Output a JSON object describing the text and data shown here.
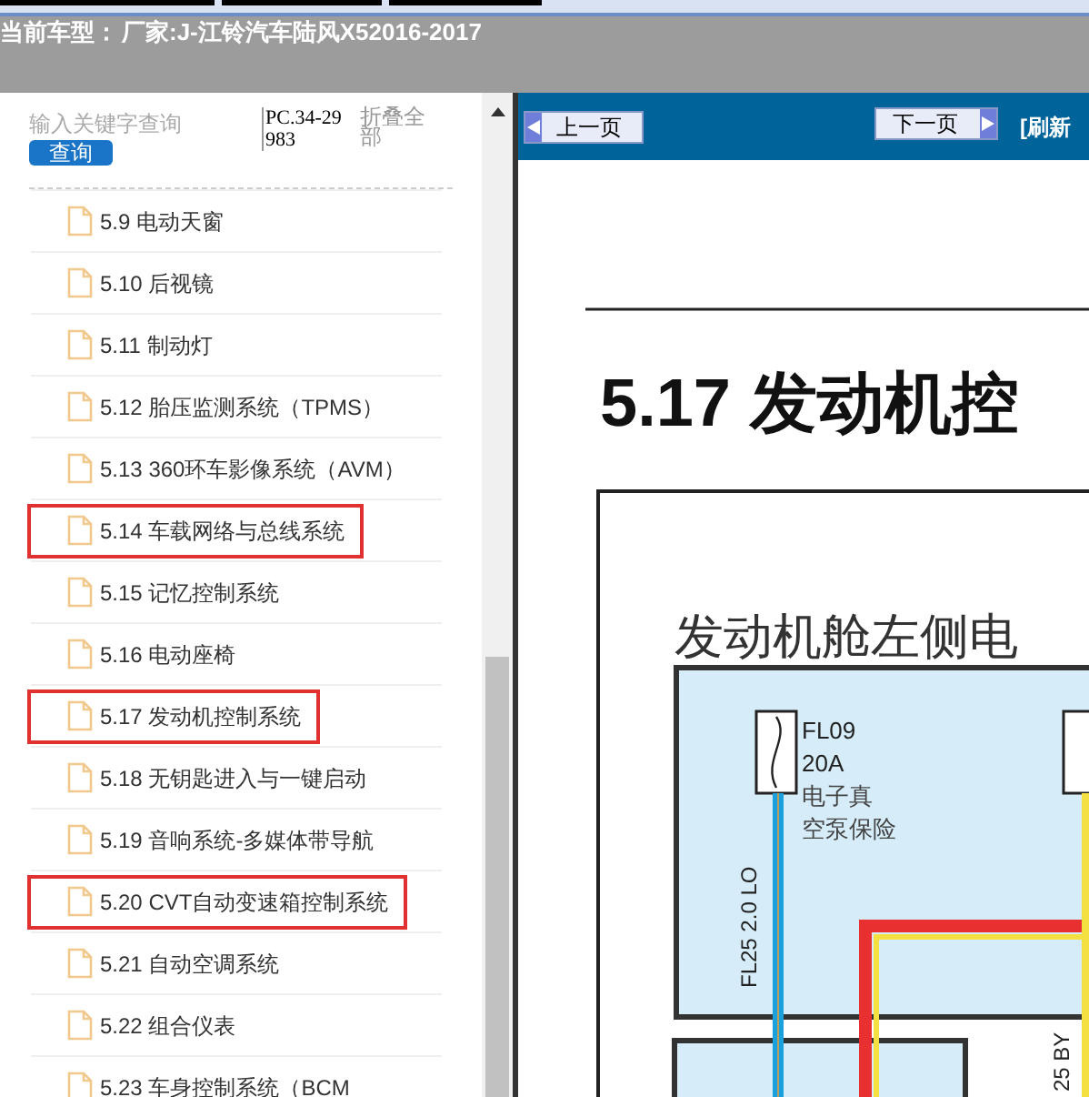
{
  "header": {
    "label": "当前车型：",
    "model": "厂家:J-江铃汽车陆风X52016-2017"
  },
  "sidebar": {
    "search": {
      "placeholder": "输入关键字查询"
    },
    "search_button": "查询",
    "code": "PC.34-29983",
    "collapse_all": "折叠全部",
    "items": [
      {
        "label": "5.9 电动天窗",
        "highlighted": false
      },
      {
        "label": "5.10 后视镜",
        "highlighted": false
      },
      {
        "label": "5.11 制动灯",
        "highlighted": false
      },
      {
        "label": "5.12 胎压监测系统（TPMS）",
        "highlighted": false
      },
      {
        "label": "5.13 360环车影像系统（AVM）",
        "highlighted": false
      },
      {
        "label": "5.14 车载网络与总线系统",
        "highlighted": true
      },
      {
        "label": "5.15 记忆控制系统",
        "highlighted": false
      },
      {
        "label": "5.16 电动座椅",
        "highlighted": false
      },
      {
        "label": "5.17 发动机控制系统",
        "highlighted": true
      },
      {
        "label": "5.18 无钥匙进入与一键启动",
        "highlighted": false
      },
      {
        "label": "5.19 音响系统-多媒体带导航",
        "highlighted": false
      },
      {
        "label": "5.20 CVT自动变速箱控制系统",
        "highlighted": true
      },
      {
        "label": "5.21 自动空调系统",
        "highlighted": false
      },
      {
        "label": "5.22 组合仪表",
        "highlighted": false
      },
      {
        "label": "5.23 车身控制系统（BCM",
        "highlighted": false
      }
    ]
  },
  "viewer": {
    "prev_button": "上一页",
    "next_button": "下一页",
    "refresh": "[刷新",
    "page": {
      "title": "5.17 发动机控",
      "panel_label": "发动机舱左侧电",
      "fuse_code": "FL09",
      "fuse_rating": "20A",
      "fuse_name_line_1": "电子真",
      "fuse_name_line_2": "空泵保险",
      "wire_label_1": "FL25 2.0 LO",
      "wire_label_2": "25 BY"
    }
  }
}
